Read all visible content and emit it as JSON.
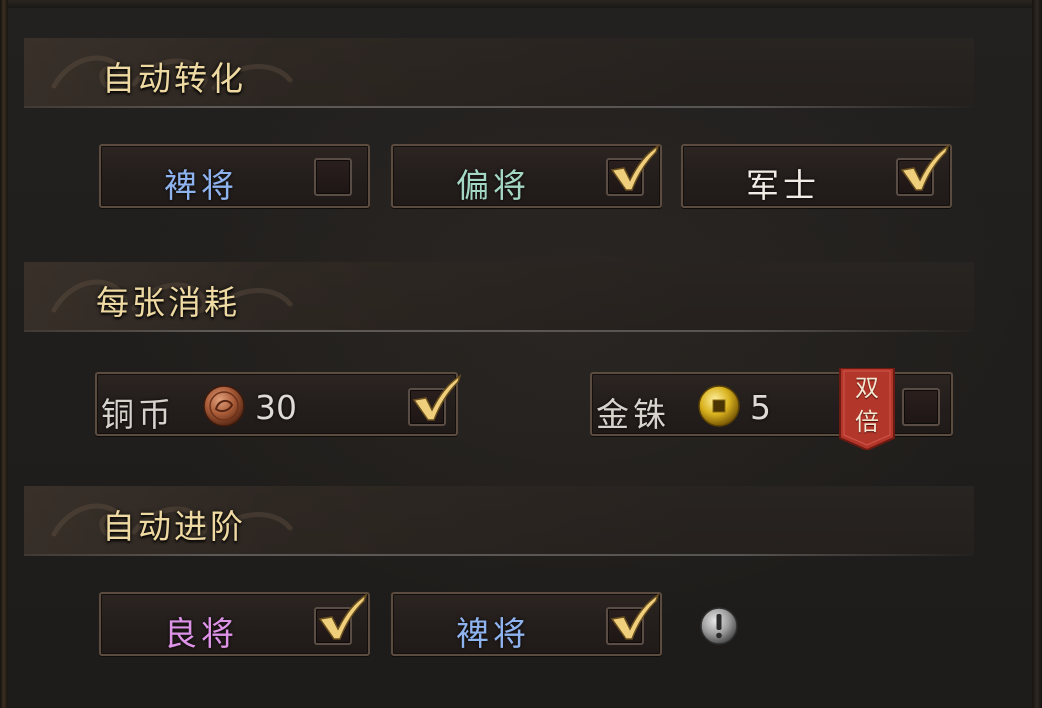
{
  "sections": {
    "auto_convert": {
      "title": "自动转化",
      "options": [
        {
          "label": "裨将",
          "checked": false,
          "color": "#8fb3ee"
        },
        {
          "label": "偏将",
          "checked": true,
          "color": "#a4d6c4"
        },
        {
          "label": "军士",
          "checked": true,
          "color": "#f1ede6"
        }
      ]
    },
    "cost_per_card": {
      "title": "每张消耗",
      "copper": {
        "label": "铜币",
        "amount": "30",
        "checked": true,
        "icon": "copper-coin-icon"
      },
      "gold": {
        "label": "金铢",
        "amount": "5",
        "checked": false,
        "icon": "gold-coin-icon",
        "badge": [
          "双",
          "倍"
        ]
      }
    },
    "auto_advance": {
      "title": "自动进阶",
      "options": [
        {
          "label": "良将",
          "checked": true,
          "color": "#de94e6"
        },
        {
          "label": "裨将",
          "checked": true,
          "color": "#8fb3ee"
        }
      ],
      "info_icon": "exclamation-info-icon"
    }
  },
  "colors": {
    "title_gold": "#eed9a2",
    "check_gold": "#f0cf7c",
    "badge_red": "#b3362a",
    "box_border": "#5b4c3f"
  }
}
